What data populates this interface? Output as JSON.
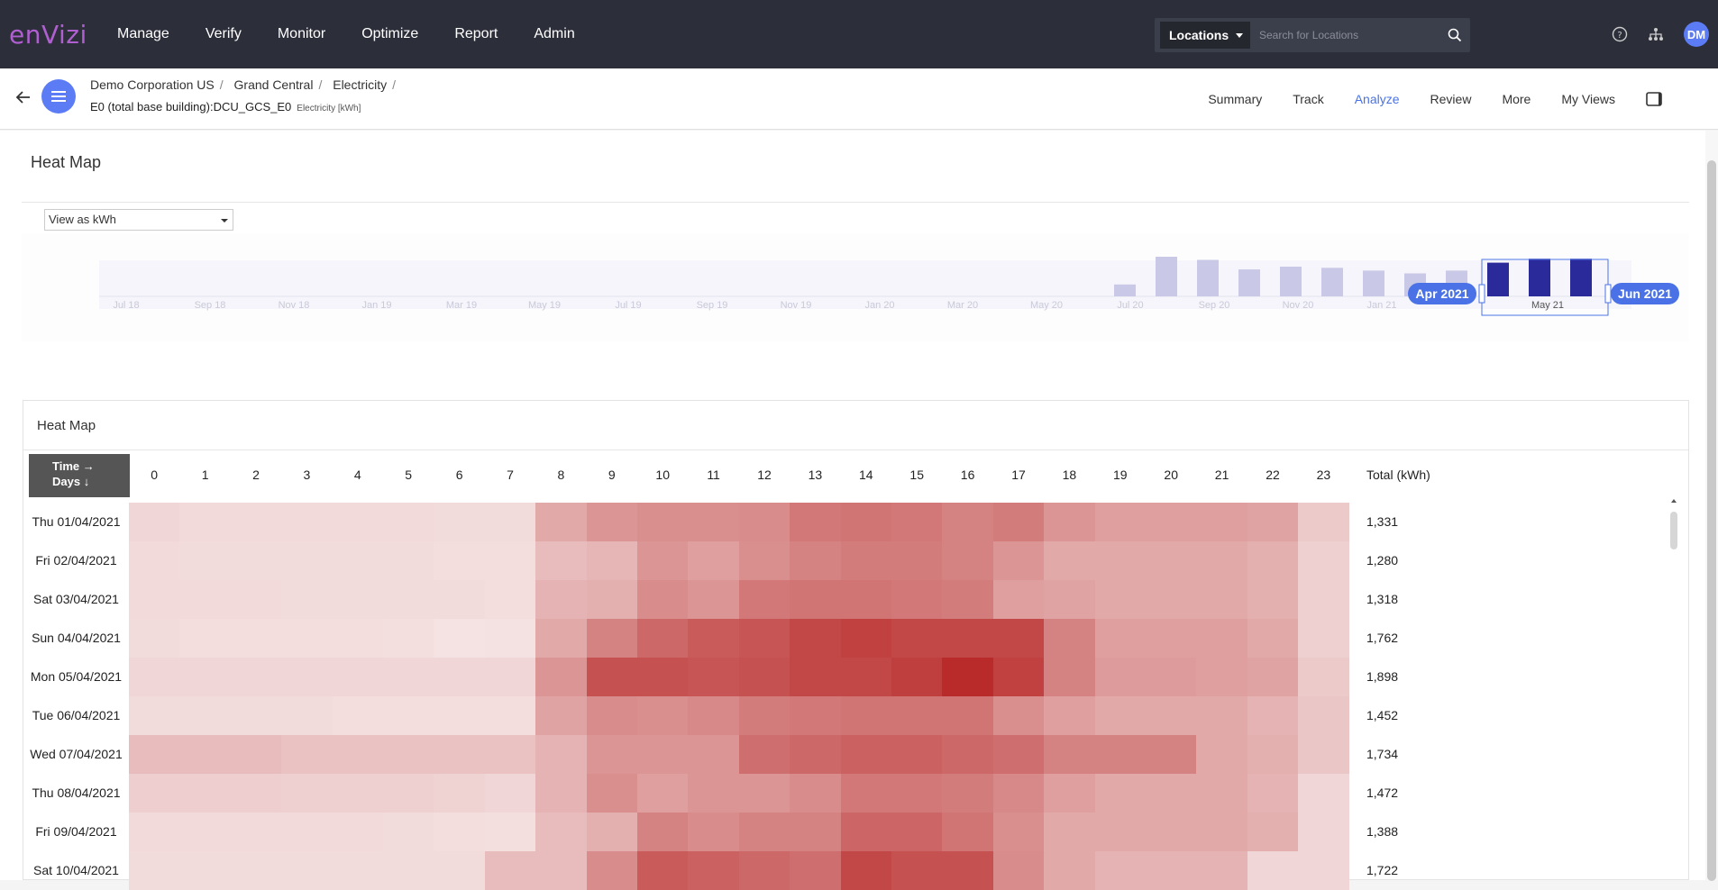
{
  "app": {
    "logo": "enVizi"
  },
  "nav": [
    "Manage",
    "Verify",
    "Monitor",
    "Optimize",
    "Report",
    "Admin"
  ],
  "search": {
    "select_label": "Locations",
    "placeholder": "Search for Locations"
  },
  "user": {
    "initials": "DM"
  },
  "breadcrumb": [
    "Demo Corporation US",
    "Grand Central",
    "Electricity"
  ],
  "entity": {
    "name": "E0 (total base building):DCU_GCS_E0",
    "unit": "Electricity [kWh]"
  },
  "tabs": [
    {
      "label": "Summary",
      "active": false
    },
    {
      "label": "Track",
      "active": false
    },
    {
      "label": "Analyze",
      "active": true
    },
    {
      "label": "Review",
      "active": false
    },
    {
      "label": "More",
      "active": false
    },
    {
      "label": "My Views",
      "active": false
    }
  ],
  "page": {
    "title": "Heat Map",
    "view_select": "View as kWh"
  },
  "timeline": {
    "labels": [
      "Jul 18",
      "Sep 18",
      "Nov 18",
      "Jan 19",
      "Mar 19",
      "May 19",
      "Jul 19",
      "Sep 19",
      "Nov 19",
      "Jan 20",
      "Mar 20",
      "May 20",
      "Jul 20",
      "Sep 20",
      "Nov 20",
      "Jan 21",
      "May 21"
    ],
    "range_start": "Apr 2021",
    "range_end": "Jun 2021",
    "bar_levels": [
      0.3,
      1.0,
      0.92,
      0.68,
      0.75,
      0.72,
      0.65,
      0.58,
      0.65,
      0.85,
      0.95,
      0.95
    ],
    "selected_from": 9
  },
  "heatmap": {
    "title": "Heat Map",
    "corner_time": "Time →",
    "corner_days": "Days ↓",
    "hours": [
      "0",
      "1",
      "2",
      "3",
      "4",
      "5",
      "6",
      "7",
      "8",
      "9",
      "10",
      "11",
      "12",
      "13",
      "14",
      "15",
      "16",
      "17",
      "18",
      "19",
      "20",
      "21",
      "22",
      "23"
    ],
    "total_header": "Total (kWh)",
    "rows": [
      {
        "date": "Thu 01/04/2021",
        "total": "1,331",
        "levels": [
          0.12,
          0.1,
          0.1,
          0.1,
          0.1,
          0.1,
          0.09,
          0.09,
          0.35,
          0.45,
          0.48,
          0.48,
          0.5,
          0.6,
          0.62,
          0.6,
          0.55,
          0.58,
          0.45,
          0.4,
          0.4,
          0.4,
          0.38,
          0.18
        ]
      },
      {
        "date": "Fri 02/04/2021",
        "total": "1,280",
        "levels": [
          0.1,
          0.09,
          0.09,
          0.09,
          0.09,
          0.09,
          0.08,
          0.08,
          0.25,
          0.28,
          0.45,
          0.4,
          0.48,
          0.55,
          0.58,
          0.58,
          0.55,
          0.45,
          0.35,
          0.35,
          0.35,
          0.35,
          0.32,
          0.15
        ]
      },
      {
        "date": "Sat 03/04/2021",
        "total": "1,318",
        "levels": [
          0.1,
          0.1,
          0.1,
          0.09,
          0.09,
          0.09,
          0.09,
          0.08,
          0.3,
          0.32,
          0.5,
          0.45,
          0.6,
          0.62,
          0.62,
          0.6,
          0.58,
          0.4,
          0.38,
          0.35,
          0.35,
          0.35,
          0.32,
          0.15
        ]
      },
      {
        "date": "Sun 04/04/2021",
        "total": "1,762",
        "levels": [
          0.09,
          0.08,
          0.08,
          0.08,
          0.08,
          0.07,
          0.05,
          0.06,
          0.35,
          0.55,
          0.68,
          0.75,
          0.78,
          0.85,
          0.88,
          0.85,
          0.85,
          0.85,
          0.55,
          0.4,
          0.4,
          0.4,
          0.35,
          0.15
        ]
      },
      {
        "date": "Mon 05/04/2021",
        "total": "1,898",
        "levels": [
          0.12,
          0.12,
          0.12,
          0.12,
          0.12,
          0.12,
          0.12,
          0.12,
          0.45,
          0.8,
          0.8,
          0.78,
          0.8,
          0.85,
          0.85,
          0.9,
          1.0,
          0.88,
          0.55,
          0.42,
          0.42,
          0.4,
          0.38,
          0.18
        ]
      },
      {
        "date": "Tue 06/04/2021",
        "total": "1,452",
        "levels": [
          0.09,
          0.09,
          0.09,
          0.09,
          0.08,
          0.08,
          0.08,
          0.08,
          0.38,
          0.5,
          0.48,
          0.52,
          0.58,
          0.6,
          0.62,
          0.62,
          0.62,
          0.48,
          0.4,
          0.35,
          0.35,
          0.35,
          0.3,
          0.2
        ]
      },
      {
        "date": "Wed 07/04/2021",
        "total": "1,734",
        "levels": [
          0.25,
          0.25,
          0.25,
          0.22,
          0.22,
          0.22,
          0.22,
          0.22,
          0.3,
          0.45,
          0.45,
          0.45,
          0.65,
          0.68,
          0.72,
          0.72,
          0.68,
          0.65,
          0.55,
          0.55,
          0.55,
          0.35,
          0.32,
          0.2
        ]
      },
      {
        "date": "Thu 08/04/2021",
        "total": "1,472",
        "levels": [
          0.16,
          0.16,
          0.16,
          0.15,
          0.15,
          0.15,
          0.14,
          0.12,
          0.3,
          0.48,
          0.4,
          0.45,
          0.45,
          0.5,
          0.6,
          0.6,
          0.58,
          0.52,
          0.4,
          0.35,
          0.35,
          0.35,
          0.3,
          0.12
        ]
      },
      {
        "date": "Fri 09/04/2021",
        "total": "1,388",
        "levels": [
          0.1,
          0.1,
          0.1,
          0.1,
          0.1,
          0.09,
          0.08,
          0.07,
          0.25,
          0.32,
          0.55,
          0.5,
          0.55,
          0.55,
          0.7,
          0.7,
          0.62,
          0.48,
          0.35,
          0.35,
          0.35,
          0.35,
          0.32,
          0.12
        ]
      },
      {
        "date": "Sat 10/04/2021",
        "total": "1,722",
        "levels": [
          0.09,
          0.09,
          0.09,
          0.09,
          0.09,
          0.09,
          0.09,
          0.25,
          0.25,
          0.5,
          0.75,
          0.72,
          0.68,
          0.65,
          0.85,
          0.8,
          0.8,
          0.5,
          0.35,
          0.3,
          0.3,
          0.3,
          0.12,
          0.12
        ]
      }
    ]
  },
  "colors": {
    "topbar": "#2c2e3a",
    "accent": "#5c7cf5",
    "heat_high": "#b92a2a",
    "heat_low": "#f8eded",
    "timeline_selected": "#2b2a9a",
    "timeline_bar": "#c9c8e6"
  }
}
